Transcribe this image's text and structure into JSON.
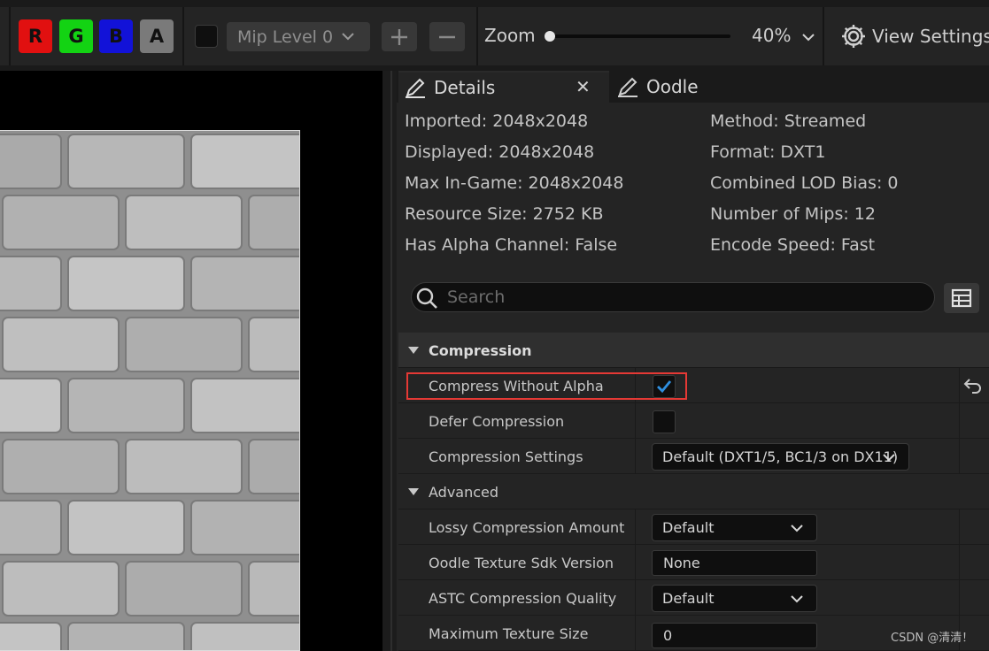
{
  "toolbar": {
    "channels": [
      {
        "label": "R",
        "color": "#e11010"
      },
      {
        "label": "G",
        "color": "#13d313"
      },
      {
        "label": "B",
        "color": "#1212d8"
      },
      {
        "label": "A",
        "color": "#7a7a7a"
      }
    ],
    "mip_level": "Mip Level 0",
    "zoom_label": "Zoom",
    "zoom_value": "40%",
    "zoom_fraction": 0.02,
    "view_settings": "View Settings"
  },
  "tabs": {
    "details": "Details",
    "oodle": "Oodle"
  },
  "info": {
    "left": [
      "Imported: 2048x2048",
      "Displayed: 2048x2048",
      "Max In-Game: 2048x2048",
      "Resource Size: 2752 KB",
      "Has Alpha Channel: False"
    ],
    "right": [
      "Method: Streamed",
      "Format: DXT1",
      "Combined LOD Bias: 0",
      "Number of Mips: 12",
      "Encode Speed: Fast"
    ]
  },
  "search": {
    "placeholder": "Search"
  },
  "properties": {
    "compression_category": "Compression",
    "compress_without_alpha": {
      "label": "Compress Without Alpha",
      "checked": true
    },
    "defer_compression": {
      "label": "Defer Compression",
      "checked": false
    },
    "compression_settings": {
      "label": "Compression Settings",
      "value": "Default (DXT1/5, BC1/3 on DX11)"
    },
    "advanced_category": "Advanced",
    "lossy_compression_amount": {
      "label": "Lossy Compression Amount",
      "value": "Default"
    },
    "oodle_sdk_version": {
      "label": "Oodle Texture Sdk Version",
      "value": "None"
    },
    "astc_quality": {
      "label": "ASTC Compression Quality",
      "value": "Default"
    },
    "max_texture_size": {
      "label": "Maximum Texture Size",
      "value": "0"
    }
  },
  "watermark": "CSDN @清清！",
  "colors": {
    "accent_check": "#2f8fe0",
    "highlight_box": "#e53935"
  }
}
